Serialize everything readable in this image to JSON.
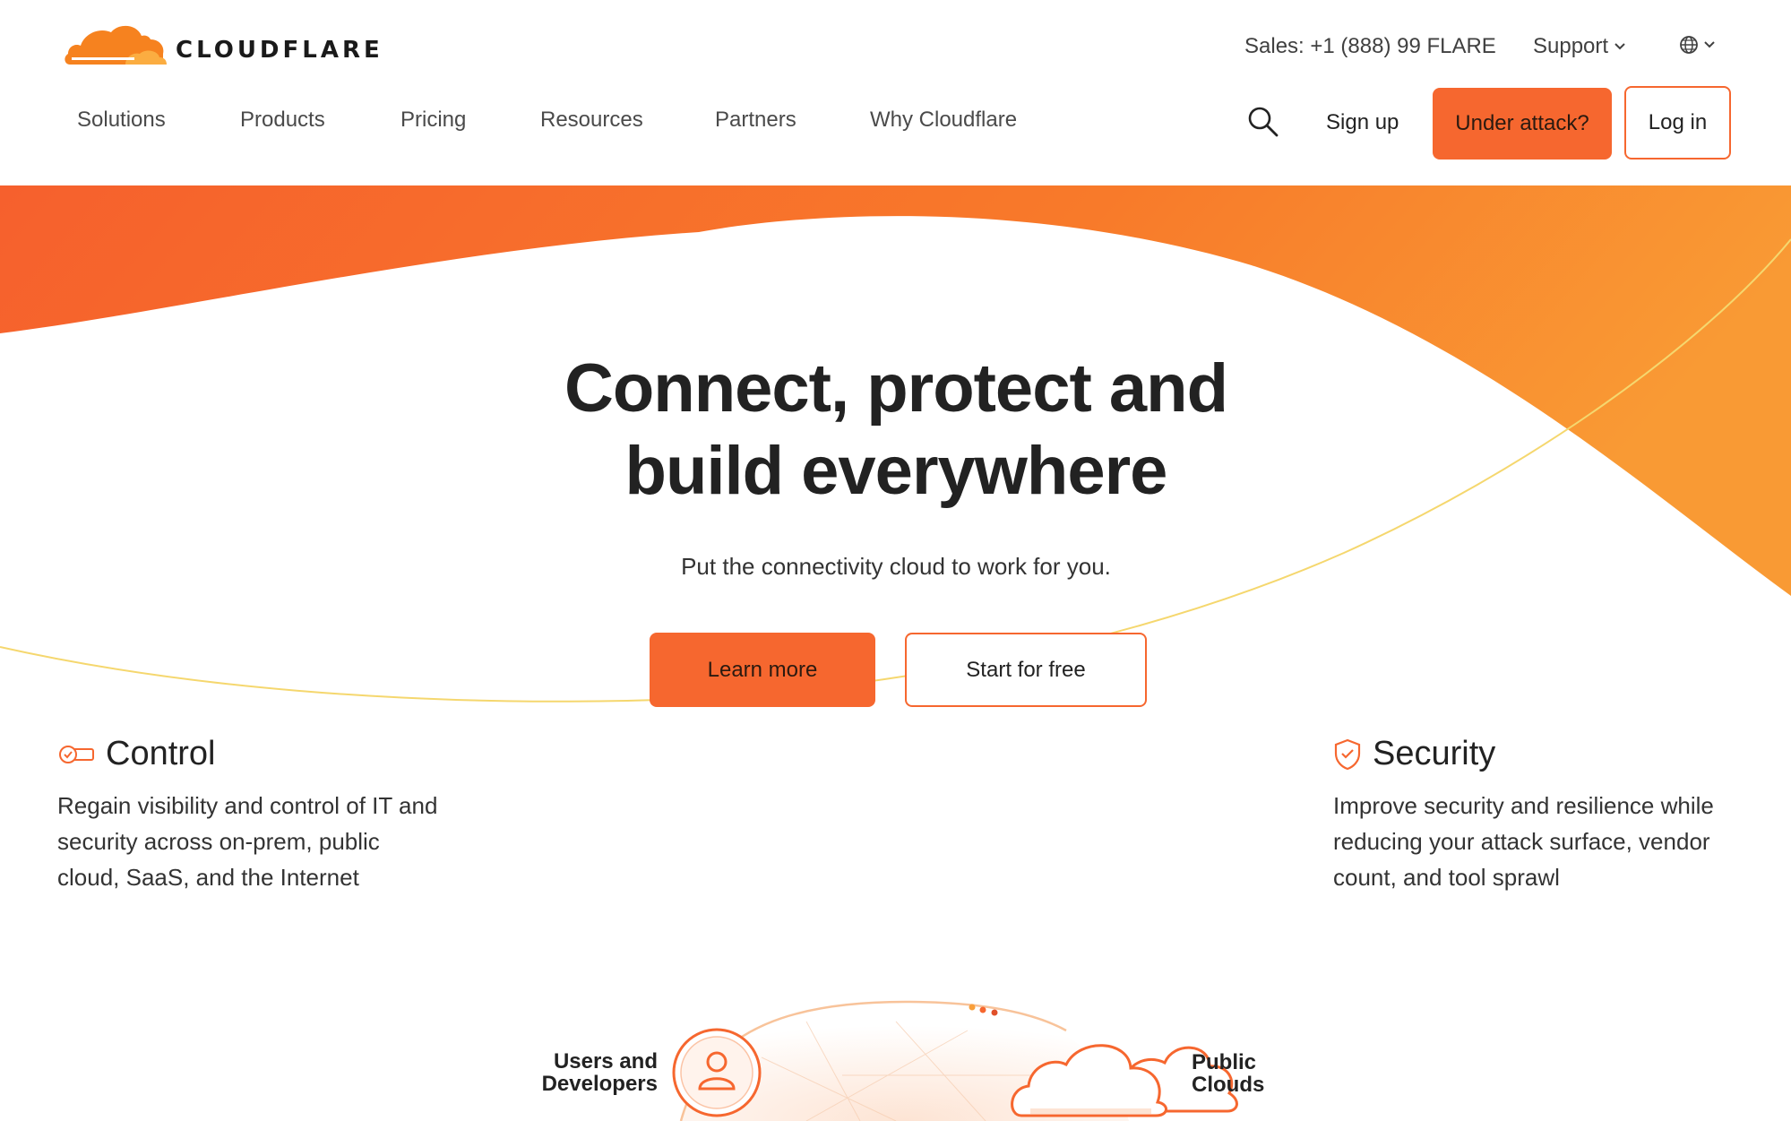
{
  "brand": {
    "name": "CLOUDFLARE",
    "accent": "#f6672f",
    "accent_light": "#f99f3a",
    "line_yellow": "#f5d76e"
  },
  "utility": {
    "sales": "Sales: +1 (888) 99 FLARE",
    "support": "Support",
    "language_icon": "globe-icon"
  },
  "nav": {
    "items": [
      "Solutions",
      "Products",
      "Pricing",
      "Resources",
      "Partners",
      "Why Cloudflare"
    ],
    "search_icon": "search-icon",
    "signup": "Sign up",
    "under_attack": "Under attack?",
    "login": "Log in"
  },
  "hero": {
    "title_line1": "Connect, protect and",
    "title_line2": "build everywhere",
    "subtitle": "Put the connectivity cloud to work for you.",
    "learn_more": "Learn more",
    "start_free": "Start for free"
  },
  "features": [
    {
      "title": "Control",
      "icon": "toggle-icon",
      "desc_lines": [
        "Regain visibility and control of IT and",
        "security across on-prem, public",
        "cloud, SaaS, and the Internet"
      ]
    },
    {
      "title": "Security",
      "icon": "shield-check-icon",
      "desc_lines": [
        "Improve security and resilience while",
        "reducing your attack surface, vendor",
        "count, and tool sprawl"
      ]
    }
  ],
  "diagram": {
    "users_line1": "Users and",
    "users_line2": "Developers",
    "clouds_line1": "Public",
    "clouds_line2": "Clouds"
  }
}
